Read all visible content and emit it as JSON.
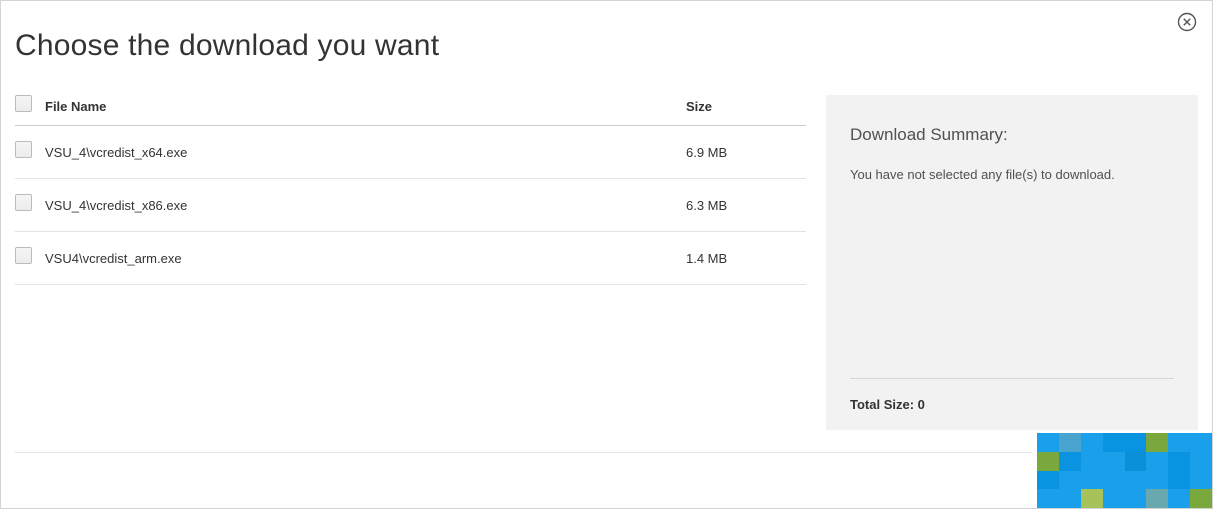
{
  "title": "Choose the download you want",
  "columns": {
    "filename": "File Name",
    "size": "Size"
  },
  "files": [
    {
      "name": "VSU_4\\vcredist_x64.exe",
      "size": "6.9 MB"
    },
    {
      "name": "VSU_4\\vcredist_x86.exe",
      "size": "6.3 MB"
    },
    {
      "name": "VSU4\\vcredist_arm.exe",
      "size": "1.4 MB"
    }
  ],
  "summary": {
    "title": "Download Summary:",
    "message": "You have not selected any file(s) to download.",
    "total_label": "Total Size: 0"
  },
  "colors": {
    "mosaic": [
      "#1a9fea",
      "#4aa4d0",
      "#1a9fea",
      "#0a93e0",
      "#0a93e0",
      "#7aa83d",
      "#1a9fea",
      "#1a9fea",
      "#7aa83d",
      "#0a93e0",
      "#1a9fea",
      "#1a9fea",
      "#0a8fd8",
      "#1a9fea",
      "#0a93e0",
      "#1a9fea",
      "#0a93e0",
      "#1a9fea",
      "#1a9fea",
      "#1a9fea",
      "#1a9fea",
      "#1a9fea",
      "#0a93e0",
      "#1a9fea",
      "#1a9fea",
      "#1a9fea",
      "#a8c25a",
      "#1a9fea",
      "#1a9fea",
      "#6aa8b0",
      "#1a9fea",
      "#7aa83d"
    ]
  }
}
